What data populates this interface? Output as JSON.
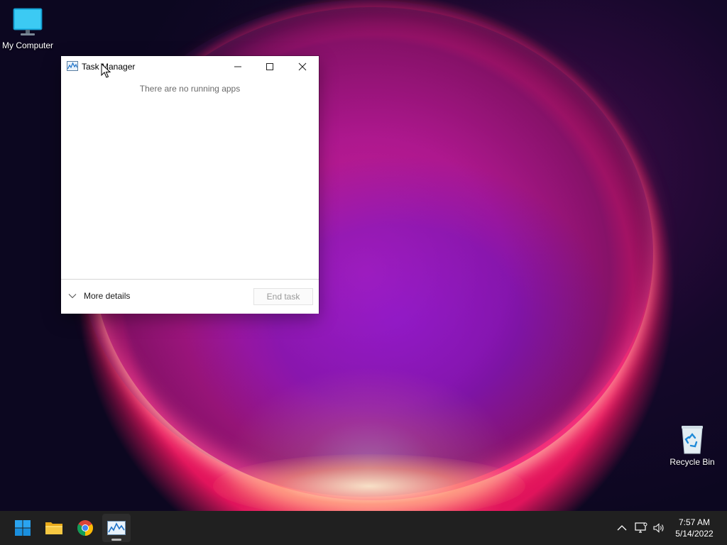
{
  "desktop": {
    "icons": [
      {
        "label": "My Computer",
        "icon": "monitor-icon"
      },
      {
        "label": "Recycle Bin",
        "icon": "recycle-bin-icon"
      }
    ]
  },
  "task_manager": {
    "title": "Task Manager",
    "message": "There are no running apps",
    "more_details_label": "More details",
    "end_task_label": "End task",
    "buttons": [
      "minimize-icon",
      "maximize-icon",
      "close-icon"
    ]
  },
  "taskbar": {
    "items": [
      "start-icon",
      "file-explorer-icon",
      "chrome-icon",
      "task-manager-icon"
    ],
    "active_item": "task-manager-icon",
    "tray": [
      "chevron-up-icon",
      "network-icon",
      "volume-icon"
    ],
    "time": "7:57 AM",
    "date": "5/14/2022"
  },
  "colors": {
    "taskbar_bg": "#202020",
    "window_bg": "#ffffff",
    "accent_blue": "#0078d4"
  }
}
